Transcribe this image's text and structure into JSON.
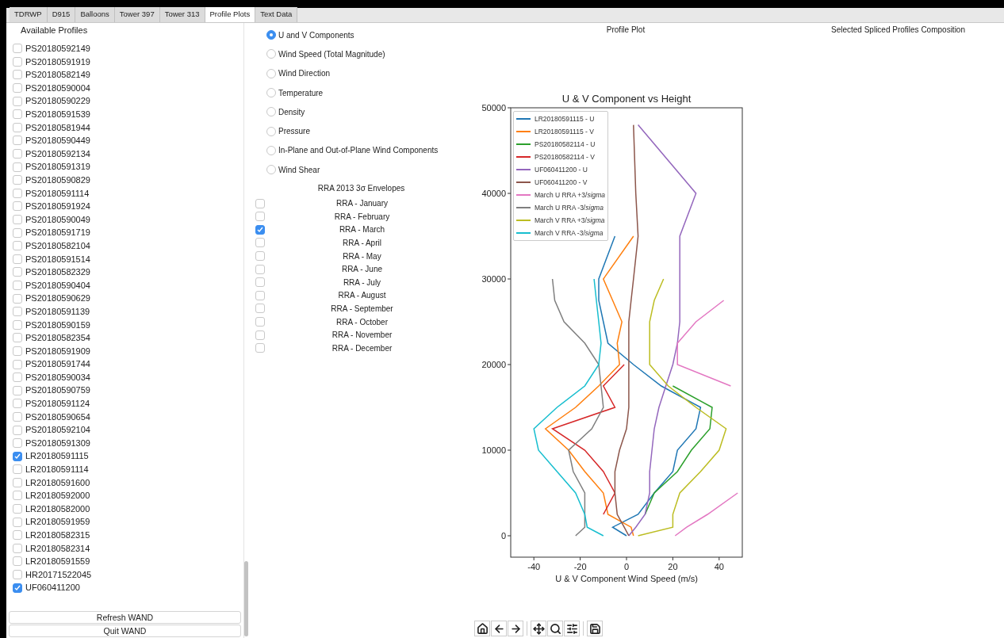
{
  "tabs": [
    {
      "label": "TDRWP",
      "selected": false
    },
    {
      "label": "D915",
      "selected": false
    },
    {
      "label": "Balloons",
      "selected": false
    },
    {
      "label": "Tower 397",
      "selected": false
    },
    {
      "label": "Tower 313",
      "selected": false
    },
    {
      "label": "Profile Plots",
      "selected": true
    },
    {
      "label": "Text Data",
      "selected": false
    }
  ],
  "profiles": {
    "title": "Available Profiles",
    "items": [
      {
        "label": "PS20180592149",
        "checked": false
      },
      {
        "label": "PS20180591919",
        "checked": false
      },
      {
        "label": "PS20180582149",
        "checked": false
      },
      {
        "label": "PS20180590004",
        "checked": false
      },
      {
        "label": "PS20180590229",
        "checked": false
      },
      {
        "label": "PS20180591539",
        "checked": false
      },
      {
        "label": "PS20180581944",
        "checked": false
      },
      {
        "label": "PS20180590449",
        "checked": false
      },
      {
        "label": "PS20180592134",
        "checked": false
      },
      {
        "label": "PS20180591319",
        "checked": false
      },
      {
        "label": "PS20180590829",
        "checked": false
      },
      {
        "label": "PS20180591114",
        "checked": false
      },
      {
        "label": "PS20180591924",
        "checked": false
      },
      {
        "label": "PS20180590049",
        "checked": false
      },
      {
        "label": "PS20180591719",
        "checked": false
      },
      {
        "label": "PS20180582104",
        "checked": false
      },
      {
        "label": "PS20180591514",
        "checked": false
      },
      {
        "label": "PS20180582329",
        "checked": false
      },
      {
        "label": "PS20180590404",
        "checked": false
      },
      {
        "label": "PS20180590629",
        "checked": false
      },
      {
        "label": "PS20180591139",
        "checked": false
      },
      {
        "label": "PS20180590159",
        "checked": false
      },
      {
        "label": "PS20180582354",
        "checked": false
      },
      {
        "label": "PS20180591909",
        "checked": false
      },
      {
        "label": "PS20180591744",
        "checked": false
      },
      {
        "label": "PS20180590034",
        "checked": false
      },
      {
        "label": "PS20180590759",
        "checked": false
      },
      {
        "label": "PS20180591124",
        "checked": false
      },
      {
        "label": "PS20180590654",
        "checked": false
      },
      {
        "label": "PS20180592104",
        "checked": false
      },
      {
        "label": "PS20180591309",
        "checked": false
      },
      {
        "label": "LR20180591115",
        "checked": true
      },
      {
        "label": "LR20180591114",
        "checked": false
      },
      {
        "label": "LR20180591600",
        "checked": false
      },
      {
        "label": "LR20180592000",
        "checked": false
      },
      {
        "label": "LR20180582000",
        "checked": false
      },
      {
        "label": "LR20180591959",
        "checked": false
      },
      {
        "label": "LR20180582315",
        "checked": false
      },
      {
        "label": "LR20180582314",
        "checked": false
      },
      {
        "label": "LR20180591559",
        "checked": false
      },
      {
        "label": "HR20171522045",
        "checked": false
      },
      {
        "label": "UF060411200",
        "checked": true
      }
    ],
    "buttons": [
      "Refresh WAND",
      "Quit WAND"
    ]
  },
  "plot_types": [
    {
      "label": "U and V Components",
      "selected": true
    },
    {
      "label": "Wind Speed (Total Magnitude)",
      "selected": false
    },
    {
      "label": "Wind Direction",
      "selected": false
    },
    {
      "label": "Temperature",
      "selected": false
    },
    {
      "label": "Density",
      "selected": false
    },
    {
      "label": "Pressure",
      "selected": false
    },
    {
      "label": "In-Plane and Out-of-Plane Wind Components",
      "selected": false
    },
    {
      "label": "Wind Shear",
      "selected": false
    }
  ],
  "envelopes": {
    "title": "RRA 2013 3σ Envelopes",
    "items": [
      {
        "label": "RRA - January",
        "checked": false
      },
      {
        "label": "RRA - February",
        "checked": false
      },
      {
        "label": "RRA - March",
        "checked": true
      },
      {
        "label": "RRA - April",
        "checked": false
      },
      {
        "label": "RRA - May",
        "checked": false
      },
      {
        "label": "RRA - June",
        "checked": false
      },
      {
        "label": "RRA - July",
        "checked": false
      },
      {
        "label": "RRA - August",
        "checked": false
      },
      {
        "label": "RRA - September",
        "checked": false
      },
      {
        "label": "RRA - October",
        "checked": false
      },
      {
        "label": "RRA - November",
        "checked": false
      },
      {
        "label": "RRA - December",
        "checked": false
      }
    ]
  },
  "profile_plot": {
    "heading": "Profile Plot",
    "chart_data": {
      "type": "line",
      "orientation": "horizontal",
      "legend": "upper left",
      "title": "U & V Component vs Height",
      "xlabel": "U & V Component Wind Speed (m/s)",
      "x": [
        0,
        1000,
        2500,
        5000,
        7500,
        10000,
        12500,
        15000,
        17500,
        20000,
        22500,
        25000,
        27500,
        30000,
        35000,
        40000,
        48000
      ],
      "xlim": [
        -50,
        50
      ],
      "ylim": [
        -2500,
        50000
      ],
      "xticks": [
        -40,
        -20,
        0,
        20,
        40
      ],
      "yticks": [
        0,
        10000,
        20000,
        30000,
        40000,
        50000
      ],
      "series": [
        {
          "name": "LR20180591115 - U",
          "color": "#1f77b4",
          "values": [
            0,
            -6,
            5,
            12,
            20,
            22,
            30,
            32,
            15,
            3,
            -8,
            -10,
            -12,
            -12,
            -5,
            null,
            null
          ]
        },
        {
          "name": "LR20180591115 - V",
          "color": "#ff7f0e",
          "values": [
            3,
            2,
            -8,
            -10,
            -18,
            -25,
            -35,
            -22,
            -12,
            -3,
            -4,
            -2,
            -6,
            -10,
            3,
            null,
            null
          ]
        },
        {
          "name": "PS20180582114 - U",
          "color": "#2ca02c",
          "values": [
            null,
            null,
            8,
            12,
            22,
            28,
            36,
            37,
            20,
            null,
            null,
            null,
            null,
            null,
            null,
            null,
            null
          ]
        },
        {
          "name": "PS20180582114 - V",
          "color": "#d62728",
          "values": [
            null,
            null,
            -10,
            -5,
            -10,
            -18,
            -32,
            -5,
            -10,
            -1,
            null,
            null,
            null,
            null,
            null,
            null,
            null
          ]
        },
        {
          "name": "UF060411200 - U",
          "color": "#9467bd",
          "values": [
            1,
            4,
            8,
            10,
            10,
            11,
            12,
            14,
            17,
            20,
            22,
            23,
            23,
            23,
            23,
            30,
            5
          ]
        },
        {
          "name": "UF060411200 - V",
          "color": "#8c564b",
          "values": [
            1,
            -1,
            -4,
            -5,
            -5,
            -3,
            0,
            1,
            1,
            1,
            1,
            1,
            2,
            3,
            5,
            4,
            3
          ]
        },
        {
          "name": "March U  RRA +3/*sigma*",
          "color": "#e377c2",
          "values": [
            21,
            26,
            35,
            48,
            null,
            null,
            null,
            null,
            45,
            22,
            22,
            30,
            42,
            null,
            null,
            null,
            null
          ]
        },
        {
          "name": "March U  RRA -3/*sigma*",
          "color": "#7f7f7f",
          "values": [
            -22,
            -18,
            -18,
            -18,
            -23,
            -25,
            -15,
            -10,
            -11,
            -12,
            -18,
            -27,
            -31,
            -32,
            null,
            null,
            null
          ]
        },
        {
          "name": "March V  RRA +3/*sigma*",
          "color": "#bcbd22",
          "values": [
            5,
            20,
            20,
            23,
            32,
            40,
            43,
            30,
            18,
            10,
            10,
            10,
            12,
            16,
            null,
            null,
            null
          ]
        },
        {
          "name": "March V  RRA -3/*sigma*",
          "color": "#17becf",
          "values": [
            -10,
            -17,
            -18,
            -22,
            -30,
            -38,
            -40,
            -30,
            -18,
            -12,
            -11,
            -12,
            -13,
            -14,
            null,
            null,
            null
          ]
        }
      ]
    }
  },
  "composition": {
    "heading": "Selected Spliced Profiles Composition"
  }
}
